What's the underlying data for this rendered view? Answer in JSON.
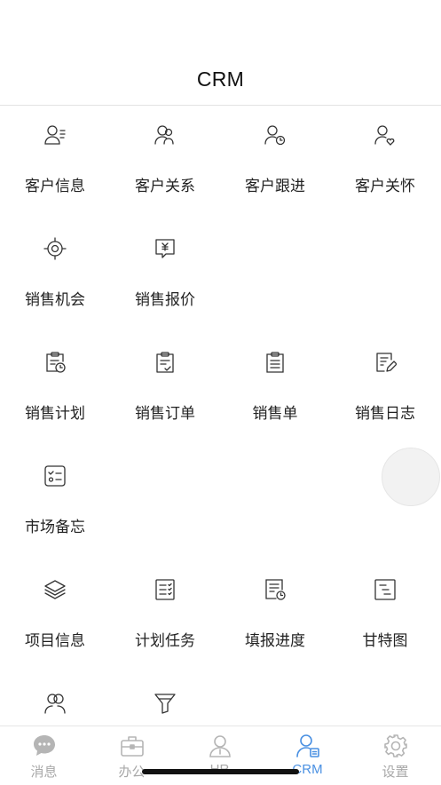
{
  "header": {
    "title": "CRM"
  },
  "tiles": [
    {
      "label": "客户信息",
      "icon": "customer-info-icon"
    },
    {
      "label": "客户关系",
      "icon": "customer-relation-icon"
    },
    {
      "label": "客户跟进",
      "icon": "customer-followup-icon"
    },
    {
      "label": "客户关怀",
      "icon": "customer-care-icon"
    },
    {
      "label": "销售机会",
      "icon": "target-icon"
    },
    {
      "label": "销售报价",
      "icon": "yuan-chat-icon"
    },
    {
      "label": "销售计划",
      "icon": "clipboard-clock-icon"
    },
    {
      "label": "销售订单",
      "icon": "clipboard-check-icon"
    },
    {
      "label": "销售单",
      "icon": "clipboard-list-icon"
    },
    {
      "label": "销售日志",
      "icon": "note-edit-icon"
    },
    {
      "label": "市场备忘",
      "icon": "checklist-icon"
    },
    {
      "label": "项目信息",
      "icon": "layers-icon"
    },
    {
      "label": "计划任务",
      "icon": "task-list-icon"
    },
    {
      "label": "填报进度",
      "icon": "doc-clock-icon"
    },
    {
      "label": "甘特图",
      "icon": "gantt-icon"
    },
    {
      "label": "",
      "icon": "users-icon"
    },
    {
      "label": "",
      "icon": "funnel-icon"
    }
  ],
  "tabs": [
    {
      "label": "消息",
      "icon": "chat-icon"
    },
    {
      "label": "办公",
      "icon": "briefcase-icon"
    },
    {
      "label": "HR",
      "icon": "person-icon"
    },
    {
      "label": "CRM",
      "icon": "crm-person-icon"
    },
    {
      "label": "设置",
      "icon": "gear-icon"
    }
  ],
  "colors": {
    "accent": "#4a90e2",
    "icon": "#333333",
    "inactive": "#a8a8a8"
  }
}
